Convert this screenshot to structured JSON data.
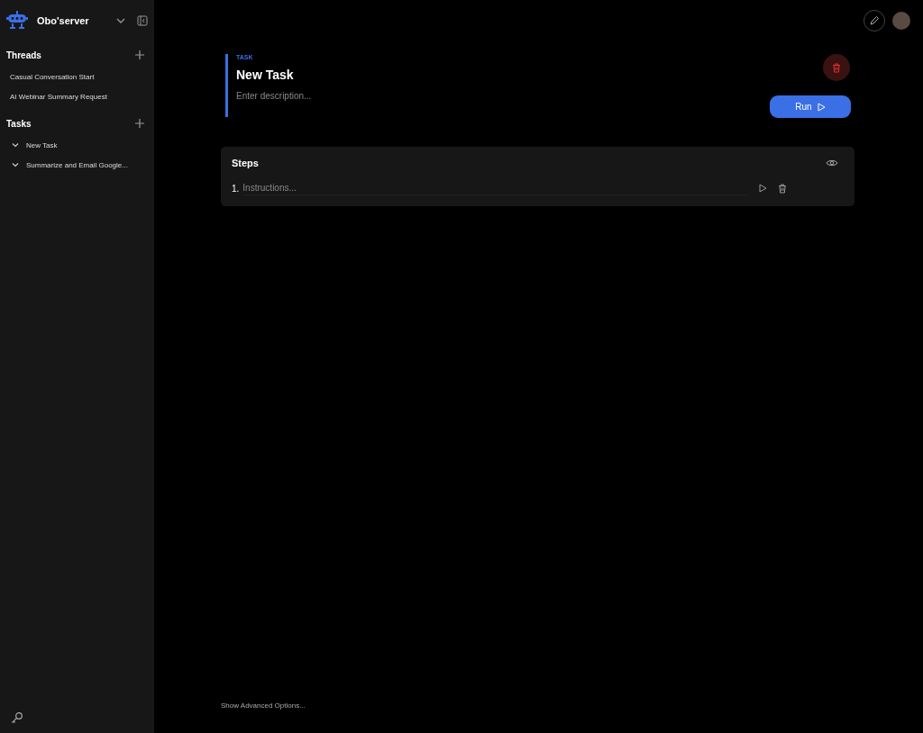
{
  "sidebar": {
    "app_name": "Obo'server",
    "sections": [
      {
        "title": "Threads",
        "items": [
          {
            "kind": "thread",
            "label": "Casual Conversation Start"
          },
          {
            "kind": "thread",
            "label": "AI Webinar Summary Request"
          }
        ]
      },
      {
        "title": "Tasks",
        "items": [
          {
            "kind": "task",
            "label": "New Task"
          },
          {
            "kind": "task",
            "label": "Summarize and Email Google..."
          }
        ]
      }
    ]
  },
  "task": {
    "eyebrow": "TASK",
    "title": "New Task",
    "description_placeholder": "Enter description...",
    "run_button": "Run"
  },
  "steps": {
    "title": "Steps",
    "items": [
      {
        "number": "1.",
        "placeholder": "Instructions..."
      }
    ]
  },
  "advanced_link": "Show Advanced Options..."
}
